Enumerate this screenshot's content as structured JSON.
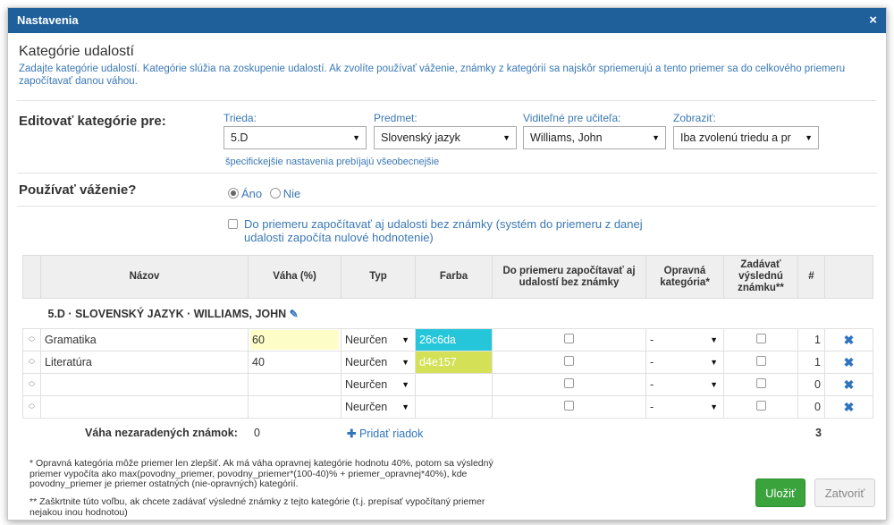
{
  "dialog": {
    "title": "Nastavenia",
    "close_icon": "×"
  },
  "section": {
    "title": "Kategórie udalostí",
    "description": "Zadajte kategórie udalostí. Kategórie slúžia na zoskupenie udalostí. Ak zvolíte používať váženie, známky z kategórií sa najskôr spriemerujú a tento priemer sa do celkového priemeru započítavať danou váhou."
  },
  "edit_for": {
    "label": "Editovať kategórie pre:",
    "trieda": {
      "label": "Trieda:",
      "value": "5.D"
    },
    "predmet": {
      "label": "Predmet:",
      "value": "Slovenský jazyk"
    },
    "ucitel": {
      "label": "Viditeľné pre učiteľa:",
      "value": "Williams, John"
    },
    "zobrazit": {
      "label": "Zobraziť:",
      "value": "Iba zvolenú triedu a pr"
    },
    "hint": "špecifickejšie nastavenia prebíjajú všeobecnejšie"
  },
  "weighting": {
    "label": "Používať váženie?",
    "yes": "Áno",
    "no": "Nie",
    "selected": "yes",
    "include_label": "Do priemeru započítavať aj udalosti bez známky (systém do priemeru z danej udalosti započíta nulové hodnotenie)"
  },
  "table": {
    "headers": {
      "nazov": "Názov",
      "vaha": "Váha (%)",
      "typ": "Typ",
      "farba": "Farba",
      "bez_znamky": "Do priemeru započítavať aj udalostí bez známky",
      "opravna": "Opravná kategória*",
      "vysledna": "Zadávať výslednú známku**",
      "count": "#"
    },
    "group_label": "5.D · SLOVENSKÝ JAZYK · WILLIAMS, JOHN",
    "rows": [
      {
        "name": "Gramatika",
        "weight": "60",
        "type": "Neurčen",
        "color": "26c6da",
        "color_hex": "#26c6da",
        "opravna": "-",
        "count": "1"
      },
      {
        "name": "Literatúra",
        "weight": "40",
        "type": "Neurčen",
        "color": "d4e157",
        "color_hex": "#d4e157",
        "opravna": "-",
        "count": "1"
      },
      {
        "name": "",
        "weight": "",
        "type": "Neurčen",
        "color": "",
        "color_hex": "",
        "opravna": "-",
        "count": "0"
      },
      {
        "name": "",
        "weight": "",
        "type": "Neurčen",
        "color": "",
        "color_hex": "",
        "opravna": "-",
        "count": "0"
      }
    ],
    "unassigned_label": "Váha nezaradených známok:",
    "unassigned_value": "0",
    "add_row": "Pridať riadok",
    "total_count": "3"
  },
  "notes": {
    "note1": "* Opravná kategória môže priemer len zlepšiť. Ak má váha opravnej kategórie hodnotu 40%, potom sa výsledný priemer vypočíta ako max(povodny_priemer, povodny_priemer*(100-40)% + priemer_opravnej*40%), kde povodny_priemer je priemer ostatných (nie-opravných) kategórií.",
    "note2": "** Zaškrtnite túto voľbu, ak chcete zadávať výsledné známky z tejto kategórie (t.j. prepísať vypočítaný priemer nejakou inou hodnotou)"
  },
  "buttons": {
    "save": "Uložiť",
    "close": "Zatvoriť"
  },
  "icons": {
    "close": "close-icon",
    "pencil": "pencil-icon",
    "plus": "plus-icon",
    "delete": "delete-icon",
    "sort": "sort-handle-icon"
  }
}
